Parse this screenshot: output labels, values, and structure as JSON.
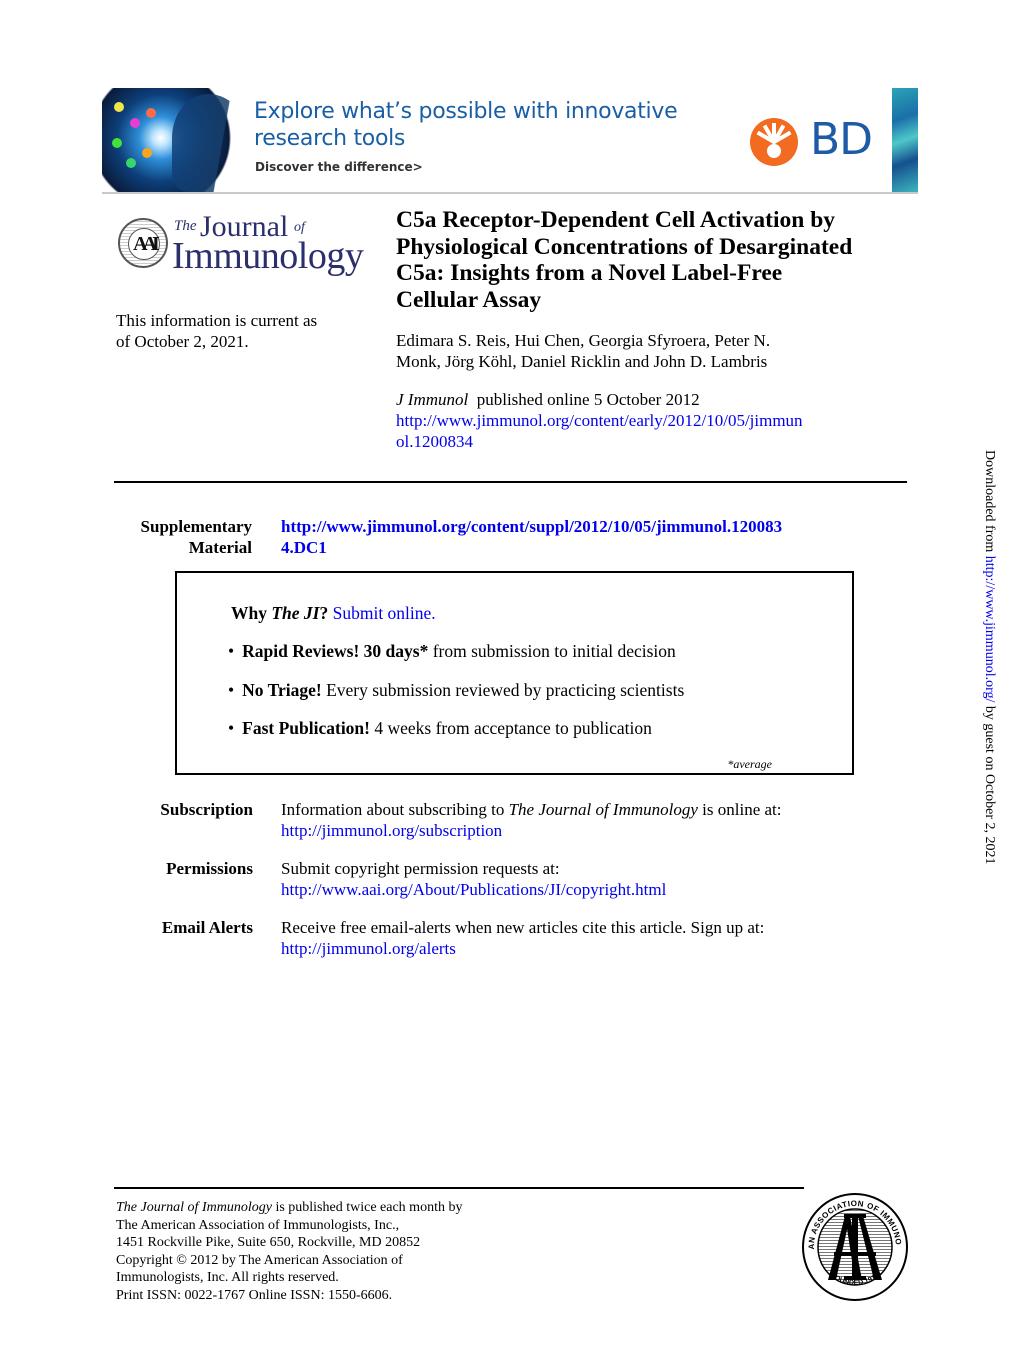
{
  "banner": {
    "headline_line1": "Explore what’s possible with innovative",
    "headline_line2": "research tools",
    "subline": "Discover the difference>",
    "brand": "BD",
    "brand_color": "#f26b21",
    "text_color": "#1a5fa5"
  },
  "journal_logo": {
    "the": "The",
    "journal": "Journal",
    "of": "of",
    "immunology": "Immunology",
    "seal_letters": "AAI",
    "color": "#2b2f6b"
  },
  "current_info": {
    "line1": "This information is current as",
    "line2": "of October 2, 2021."
  },
  "article": {
    "title_lines": [
      "C5a Receptor-Dependent Cell Activation by",
      "Physiological Concentrations of Desarginated",
      "C5a: Insights from a Novel Label-Free",
      "Cellular Assay"
    ],
    "authors_lines": [
      "Edimara S. Reis, Hui Chen, Georgia Sfyroera, Peter N.",
      "Monk, Jörg Köhl, Daniel Ricklin and John D. Lambris"
    ],
    "journal_abbrev": "J Immunol",
    "published": "published online 5 October 2012",
    "url_line1": "http://www.jimmunol.org/content/early/2012/10/05/jimmun",
    "url_line2": "ol.1200834"
  },
  "supplementary": {
    "label_line1": "Supplementary",
    "label_line2": "Material",
    "url_line1": "http://www.jimmunol.org/content/suppl/2012/10/05/jimmunol.120083",
    "url_line2": "4.DC1"
  },
  "why_box": {
    "why": "Why",
    "the_ji": "The JI",
    "question": "?",
    "submit_link": "Submit online.",
    "bullets": [
      {
        "bold": "Rapid Reviews! 30 days*",
        "text": " from submission to initial decision"
      },
      {
        "bold": "No Triage!",
        "text": " Every submission reviewed by practicing scientists"
      },
      {
        "bold": "Fast Publication!",
        "text": " 4 weeks from acceptance to publication"
      }
    ],
    "bullet_char": "•",
    "note": "*average"
  },
  "info_rows": [
    {
      "label": "Subscription",
      "text_pre": "Information about subscribing to ",
      "text_italic": "The Journal of Immunology",
      "text_post": " is online at:",
      "link": "http://jimmunol.org/subscription"
    },
    {
      "label": "Permissions",
      "text_pre": "Submit copyright permission requests at:",
      "text_italic": "",
      "text_post": "",
      "link": "http://www.aai.org/About/Publications/JI/copyright.html"
    },
    {
      "label": "Email Alerts",
      "text_pre": "Receive free email-alerts when new articles cite this article. Sign up at:",
      "text_italic": "",
      "text_post": "",
      "link": "http://jimmunol.org/alerts"
    }
  ],
  "footer": {
    "journal_italic": "The Journal of Immunology",
    "line1_rest": " is published twice each month by",
    "line2": "The American Association of Immunologists, Inc.,",
    "line3": "1451 Rockville Pike, Suite 650, Rockville, MD 20852",
    "line4": "Copyright © 2012 by The American Association of",
    "line5": "Immunologists, Inc. All rights reserved.",
    "line6": "Print ISSN: 0022-1767 Online ISSN: 1550-6606.",
    "seal_top_text": "AMERICAN ASSOCIATION OF IMMUNOLOGISTS",
    "seal_bottom_text": "FOUNDED 1913"
  },
  "side_note": {
    "prefix": "Downloaded from ",
    "link": "http://www.jimmunol.org/",
    "suffix": " by guest on October 2, 2021"
  }
}
